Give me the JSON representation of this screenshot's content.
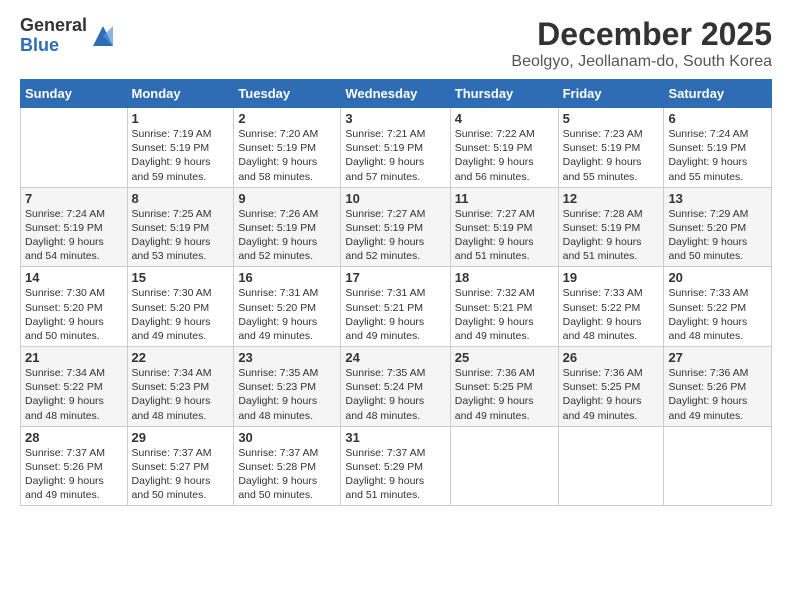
{
  "logo": {
    "general": "General",
    "blue": "Blue"
  },
  "title": "December 2025",
  "location": "Beolgyo, Jeollanam-do, South Korea",
  "days_header": [
    "Sunday",
    "Monday",
    "Tuesday",
    "Wednesday",
    "Thursday",
    "Friday",
    "Saturday"
  ],
  "weeks": [
    [
      {
        "day": "",
        "info": ""
      },
      {
        "day": "1",
        "info": "Sunrise: 7:19 AM\nSunset: 5:19 PM\nDaylight: 9 hours\nand 59 minutes."
      },
      {
        "day": "2",
        "info": "Sunrise: 7:20 AM\nSunset: 5:19 PM\nDaylight: 9 hours\nand 58 minutes."
      },
      {
        "day": "3",
        "info": "Sunrise: 7:21 AM\nSunset: 5:19 PM\nDaylight: 9 hours\nand 57 minutes."
      },
      {
        "day": "4",
        "info": "Sunrise: 7:22 AM\nSunset: 5:19 PM\nDaylight: 9 hours\nand 56 minutes."
      },
      {
        "day": "5",
        "info": "Sunrise: 7:23 AM\nSunset: 5:19 PM\nDaylight: 9 hours\nand 55 minutes."
      },
      {
        "day": "6",
        "info": "Sunrise: 7:24 AM\nSunset: 5:19 PM\nDaylight: 9 hours\nand 55 minutes."
      }
    ],
    [
      {
        "day": "7",
        "info": "Sunrise: 7:24 AM\nSunset: 5:19 PM\nDaylight: 9 hours\nand 54 minutes."
      },
      {
        "day": "8",
        "info": "Sunrise: 7:25 AM\nSunset: 5:19 PM\nDaylight: 9 hours\nand 53 minutes."
      },
      {
        "day": "9",
        "info": "Sunrise: 7:26 AM\nSunset: 5:19 PM\nDaylight: 9 hours\nand 52 minutes."
      },
      {
        "day": "10",
        "info": "Sunrise: 7:27 AM\nSunset: 5:19 PM\nDaylight: 9 hours\nand 52 minutes."
      },
      {
        "day": "11",
        "info": "Sunrise: 7:27 AM\nSunset: 5:19 PM\nDaylight: 9 hours\nand 51 minutes."
      },
      {
        "day": "12",
        "info": "Sunrise: 7:28 AM\nSunset: 5:19 PM\nDaylight: 9 hours\nand 51 minutes."
      },
      {
        "day": "13",
        "info": "Sunrise: 7:29 AM\nSunset: 5:20 PM\nDaylight: 9 hours\nand 50 minutes."
      }
    ],
    [
      {
        "day": "14",
        "info": "Sunrise: 7:30 AM\nSunset: 5:20 PM\nDaylight: 9 hours\nand 50 minutes."
      },
      {
        "day": "15",
        "info": "Sunrise: 7:30 AM\nSunset: 5:20 PM\nDaylight: 9 hours\nand 49 minutes."
      },
      {
        "day": "16",
        "info": "Sunrise: 7:31 AM\nSunset: 5:20 PM\nDaylight: 9 hours\nand 49 minutes."
      },
      {
        "day": "17",
        "info": "Sunrise: 7:31 AM\nSunset: 5:21 PM\nDaylight: 9 hours\nand 49 minutes."
      },
      {
        "day": "18",
        "info": "Sunrise: 7:32 AM\nSunset: 5:21 PM\nDaylight: 9 hours\nand 49 minutes."
      },
      {
        "day": "19",
        "info": "Sunrise: 7:33 AM\nSunset: 5:22 PM\nDaylight: 9 hours\nand 48 minutes."
      },
      {
        "day": "20",
        "info": "Sunrise: 7:33 AM\nSunset: 5:22 PM\nDaylight: 9 hours\nand 48 minutes."
      }
    ],
    [
      {
        "day": "21",
        "info": "Sunrise: 7:34 AM\nSunset: 5:22 PM\nDaylight: 9 hours\nand 48 minutes."
      },
      {
        "day": "22",
        "info": "Sunrise: 7:34 AM\nSunset: 5:23 PM\nDaylight: 9 hours\nand 48 minutes."
      },
      {
        "day": "23",
        "info": "Sunrise: 7:35 AM\nSunset: 5:23 PM\nDaylight: 9 hours\nand 48 minutes."
      },
      {
        "day": "24",
        "info": "Sunrise: 7:35 AM\nSunset: 5:24 PM\nDaylight: 9 hours\nand 48 minutes."
      },
      {
        "day": "25",
        "info": "Sunrise: 7:36 AM\nSunset: 5:25 PM\nDaylight: 9 hours\nand 49 minutes."
      },
      {
        "day": "26",
        "info": "Sunrise: 7:36 AM\nSunset: 5:25 PM\nDaylight: 9 hours\nand 49 minutes."
      },
      {
        "day": "27",
        "info": "Sunrise: 7:36 AM\nSunset: 5:26 PM\nDaylight: 9 hours\nand 49 minutes."
      }
    ],
    [
      {
        "day": "28",
        "info": "Sunrise: 7:37 AM\nSunset: 5:26 PM\nDaylight: 9 hours\nand 49 minutes."
      },
      {
        "day": "29",
        "info": "Sunrise: 7:37 AM\nSunset: 5:27 PM\nDaylight: 9 hours\nand 50 minutes."
      },
      {
        "day": "30",
        "info": "Sunrise: 7:37 AM\nSunset: 5:28 PM\nDaylight: 9 hours\nand 50 minutes."
      },
      {
        "day": "31",
        "info": "Sunrise: 7:37 AM\nSunset: 5:29 PM\nDaylight: 9 hours\nand 51 minutes."
      },
      {
        "day": "",
        "info": ""
      },
      {
        "day": "",
        "info": ""
      },
      {
        "day": "",
        "info": ""
      }
    ]
  ]
}
